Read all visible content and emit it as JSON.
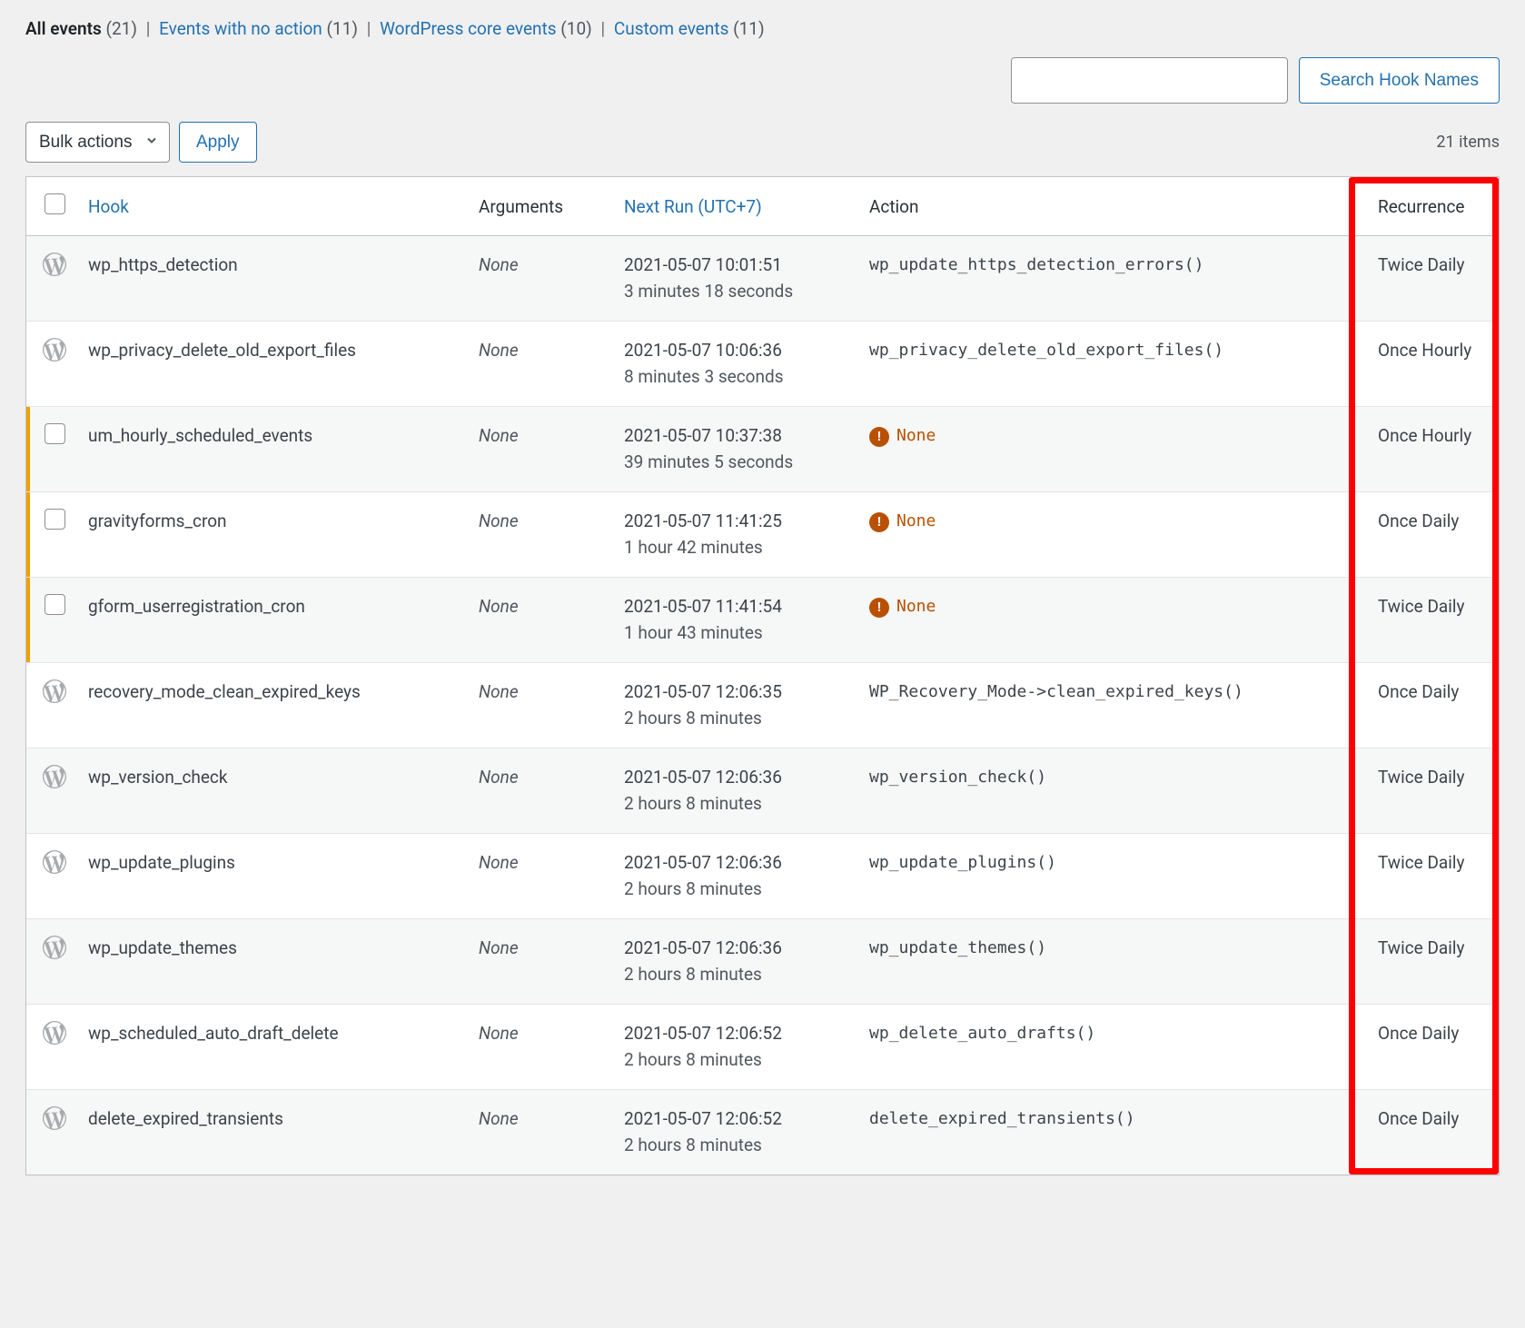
{
  "filters": {
    "all": {
      "label": "All events",
      "count": "(21)"
    },
    "noaction": {
      "label": "Events with no action",
      "count": "(11)"
    },
    "core": {
      "label": "WordPress core events",
      "count": "(10)"
    },
    "custom": {
      "label": "Custom events",
      "count": "(11)"
    }
  },
  "search": {
    "button": "Search Hook Names",
    "placeholder": ""
  },
  "bulk": {
    "label": "Bulk actions",
    "apply": "Apply"
  },
  "items_count": "21 items",
  "columns": {
    "hook": "Hook",
    "args": "Arguments",
    "nextrun": "Next Run (UTC+7)",
    "action": "Action",
    "recurrence": "Recurrence"
  },
  "none_label": "None",
  "rows": [
    {
      "icon": "wp",
      "hook": "wp_https_detection",
      "args": "None",
      "next": "2021-05-07 10:01:51",
      "rel": "3 minutes 18 seconds",
      "action": "wp_update_https_detection_errors()",
      "action_none": false,
      "recur": "Twice Daily",
      "bar": false
    },
    {
      "icon": "wp",
      "hook": "wp_privacy_delete_old_export_files",
      "args": "None",
      "next": "2021-05-07 10:06:36",
      "rel": "8 minutes 3 seconds",
      "action": "wp_privacy_delete_old_export_files()",
      "action_none": false,
      "recur": "Once Hourly",
      "bar": false
    },
    {
      "icon": "check",
      "hook": "um_hourly_scheduled_events",
      "args": "None",
      "next": "2021-05-07 10:37:38",
      "rel": "39 minutes 5 seconds",
      "action": "None",
      "action_none": true,
      "recur": "Once Hourly",
      "bar": true
    },
    {
      "icon": "check",
      "hook": "gravityforms_cron",
      "args": "None",
      "next": "2021-05-07 11:41:25",
      "rel": "1 hour 42 minutes",
      "action": "None",
      "action_none": true,
      "recur": "Once Daily",
      "bar": true
    },
    {
      "icon": "check",
      "hook": "gform_userregistration_cron",
      "args": "None",
      "next": "2021-05-07 11:41:54",
      "rel": "1 hour 43 minutes",
      "action": "None",
      "action_none": true,
      "recur": "Twice Daily",
      "bar": true
    },
    {
      "icon": "wp",
      "hook": "recovery_mode_clean_expired_keys",
      "args": "None",
      "next": "2021-05-07 12:06:35",
      "rel": "2 hours 8 minutes",
      "action": "WP_Recovery_Mode->clean_expired_keys()",
      "action_none": false,
      "recur": "Once Daily",
      "bar": false
    },
    {
      "icon": "wp",
      "hook": "wp_version_check",
      "args": "None",
      "next": "2021-05-07 12:06:36",
      "rel": "2 hours 8 minutes",
      "action": "wp_version_check()",
      "action_none": false,
      "recur": "Twice Daily",
      "bar": false
    },
    {
      "icon": "wp",
      "hook": "wp_update_plugins",
      "args": "None",
      "next": "2021-05-07 12:06:36",
      "rel": "2 hours 8 minutes",
      "action": "wp_update_plugins()",
      "action_none": false,
      "recur": "Twice Daily",
      "bar": false
    },
    {
      "icon": "wp",
      "hook": "wp_update_themes",
      "args": "None",
      "next": "2021-05-07 12:06:36",
      "rel": "2 hours 8 minutes",
      "action": "wp_update_themes()",
      "action_none": false,
      "recur": "Twice Daily",
      "bar": false
    },
    {
      "icon": "wp",
      "hook": "wp_scheduled_auto_draft_delete",
      "args": "None",
      "next": "2021-05-07 12:06:52",
      "rel": "2 hours 8 minutes",
      "action": "wp_delete_auto_drafts()",
      "action_none": false,
      "recur": "Once Daily",
      "bar": false
    },
    {
      "icon": "wp",
      "hook": "delete_expired_transients",
      "args": "None",
      "next": "2021-05-07 12:06:52",
      "rel": "2 hours 8 minutes",
      "action": "delete_expired_transients()",
      "action_none": false,
      "recur": "Once Daily",
      "bar": false
    }
  ]
}
